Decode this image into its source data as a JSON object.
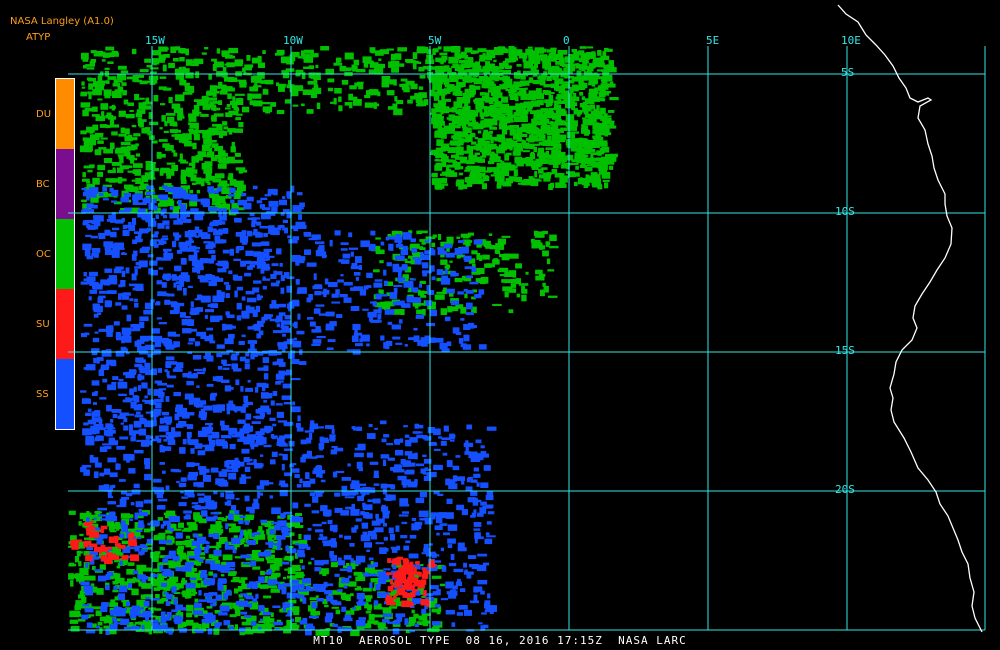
{
  "header": {
    "line1": "NASA Langley (A1.0)",
    "line2": "ATYP"
  },
  "legend": {
    "items": [
      {
        "label": "DU",
        "color": "#ff8c00"
      },
      {
        "label": "BC",
        "color": "#7a0e8e"
      },
      {
        "label": "OC",
        "color": "#00c000"
      },
      {
        "label": "SU",
        "color": "#ff1a1a"
      },
      {
        "label": "SS",
        "color": "#1450ff"
      }
    ]
  },
  "map": {
    "grid_color": "#35e6e6",
    "coast_color": "#ffffff",
    "lon_labels": [
      "15W",
      "10W",
      "5W",
      "0",
      "5E",
      "10E"
    ],
    "lat_labels": [
      "5S",
      "10S",
      "15S",
      "20S"
    ]
  },
  "caption": "MT10  AEROSOL TYPE  08 16, 2016 17:15Z  NASA LARC"
}
